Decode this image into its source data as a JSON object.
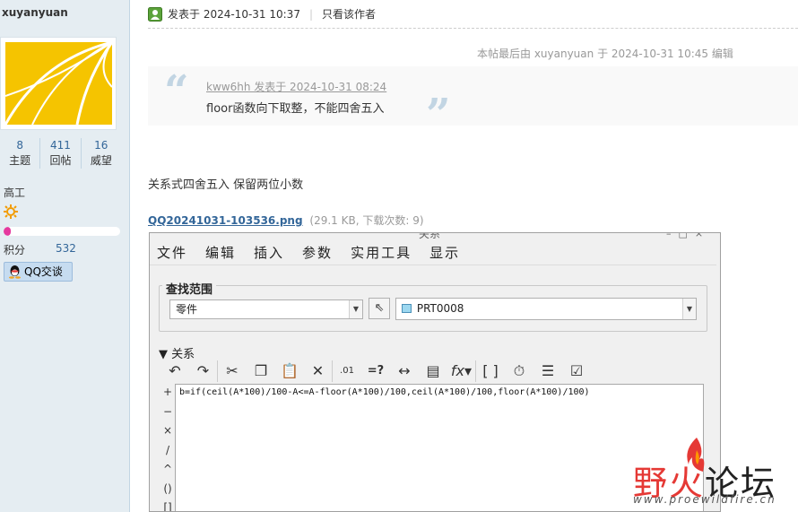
{
  "sidebar": {
    "username": "xuyanyuan",
    "stats": [
      {
        "value": "8",
        "label": "主题"
      },
      {
        "value": "411",
        "label": "回帖"
      },
      {
        "value": "16",
        "label": "威望"
      }
    ],
    "rank": "高工",
    "points_label": "积分",
    "points_value": "532",
    "level_progress": 0.06,
    "qq_label": "QQ交谈"
  },
  "post": {
    "posted_at": "发表于 2024-10-31 10:37",
    "author_only": "只看该作者",
    "edit_note": "本帖最后由 xuyanyuan 于 2024-10-31 10:45 编辑",
    "quote": {
      "author_line": "kww6hh 发表于 2024-10-31 08:24",
      "text": "floor函数向下取整，不能四舍五入"
    },
    "body": "关系式四舍五入 保留两位小数",
    "attachment": {
      "name": "QQ20241031-103536.png",
      "meta": "(29.1 KB, 下载次数: 9)"
    }
  },
  "screenshot": {
    "title": "关系",
    "window_controls": "–□×",
    "menu": [
      "文件",
      "编辑",
      "插入",
      "参数",
      "实用工具",
      "显示"
    ],
    "scope_legend": "查找范围",
    "scope_type": "零件",
    "scope_model": "PRT0008",
    "relations_header": "▼ 关系",
    "toolbar_icons": [
      "undo-icon",
      "redo-icon",
      "cut-icon",
      "copy-icon",
      "paste-icon",
      "delete-icon",
      "units-icon",
      "evaluate-icon",
      "dimension-icon",
      "properties-icon",
      "function-icon",
      "parameters-icon",
      "verify-icon",
      "sort-icon",
      "list-icon"
    ],
    "operators": [
      "+",
      "−",
      "×",
      "/",
      "^",
      "()",
      "[]"
    ],
    "relation_text": "b=if(ceil(A*100)/100-A<=A-floor(A*100)/100,ceil(A*100)/100,floor(A*100)/100)"
  },
  "watermark": {
    "brand_red": "野火",
    "brand_dark": "论坛",
    "url": "www.proewildfire.cn"
  }
}
